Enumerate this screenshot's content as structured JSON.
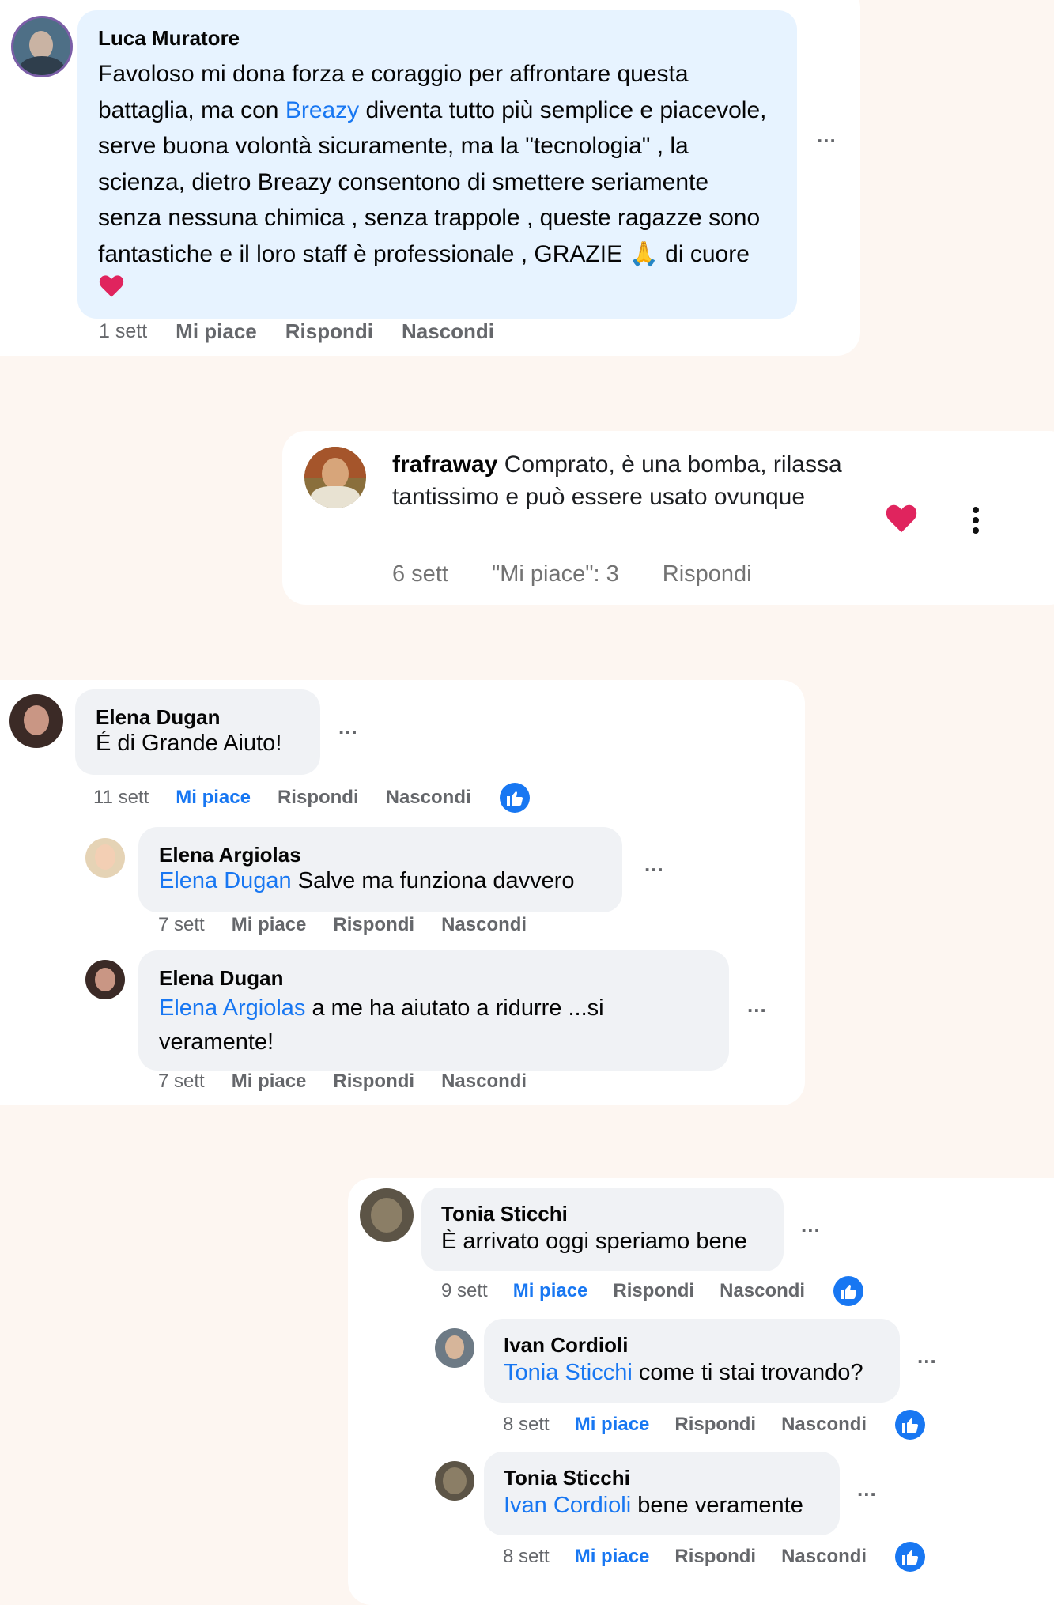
{
  "colors": {
    "page_bg": "#fdf6f1",
    "bubble": "#f0f2f5",
    "bubble_blue": "#e7f3ff",
    "link": "#1877f2",
    "muted": "#65676b",
    "heart": "#e0245e"
  },
  "c1": {
    "author": "Luca Muratore",
    "text_a": "Favoloso mi dona forza e coraggio per affrontare questa battaglia, ma con ",
    "mention": "Breazy",
    "text_b": " diventa tutto più semplice e piacevole, serve buona volontà sicuramente, ma la \"tecnologia\" , la scienza, dietro Breazy consentono di smettere seriamente senza nessuna chimica , senza trappole , queste ragazze sono fantastiche e il loro staff è professionale , GRAZIE ",
    "emoji_pray": "🙏",
    "text_c": " di cuore ",
    "time": "1 sett",
    "like": "Mi piace",
    "reply": "Rispondi",
    "hide": "Nascondi",
    "more": "..."
  },
  "c2": {
    "author": "frafraway",
    "text": " Comprato, è una bomba, rilassa tantissimo e può essere usato ovunque",
    "time": "6 sett",
    "likes": "\"Mi piace\": 3",
    "reply": "Rispondi"
  },
  "c3": {
    "main": {
      "author": "Elena Dugan",
      "text": "É di Grande Aiuto!",
      "time": "11 sett",
      "like": "Mi piace",
      "reply": "Rispondi",
      "hide": "Nascondi",
      "more": "..."
    },
    "reply1": {
      "author": "Elena Argiolas",
      "mention": "Elena Dugan",
      "text": " Salve ma funziona davvero",
      "time": "7 sett",
      "like": "Mi piace",
      "reply": "Rispondi",
      "hide": "Nascondi",
      "more": "..."
    },
    "reply2": {
      "author": "Elena Dugan",
      "mention": "Elena Argiolas",
      "text": " a me ha aiutato a ridurre ...si veramente!",
      "time": "7 sett",
      "like": "Mi piace",
      "reply": "Rispondi",
      "hide": "Nascondi",
      "more": "..."
    }
  },
  "c4": {
    "main": {
      "author": "Tonia Sticchi",
      "text": "È arrivato oggi speriamo bene",
      "time": "9 sett",
      "like": "Mi piace",
      "reply": "Rispondi",
      "hide": "Nascondi",
      "more": "..."
    },
    "reply1": {
      "author": "Ivan Cordioli",
      "mention": "Tonia Sticchi",
      "text": " come ti stai trovando?",
      "time": "8 sett",
      "like": "Mi piace",
      "reply": "Rispondi",
      "hide": "Nascondi",
      "more": "..."
    },
    "reply2": {
      "author": "Tonia Sticchi",
      "mention": "Ivan Cordioli",
      "text": " bene veramente",
      "time": "8 sett",
      "like": "Mi piace",
      "reply": "Rispondi",
      "hide": "Nascondi",
      "more": "..."
    }
  }
}
